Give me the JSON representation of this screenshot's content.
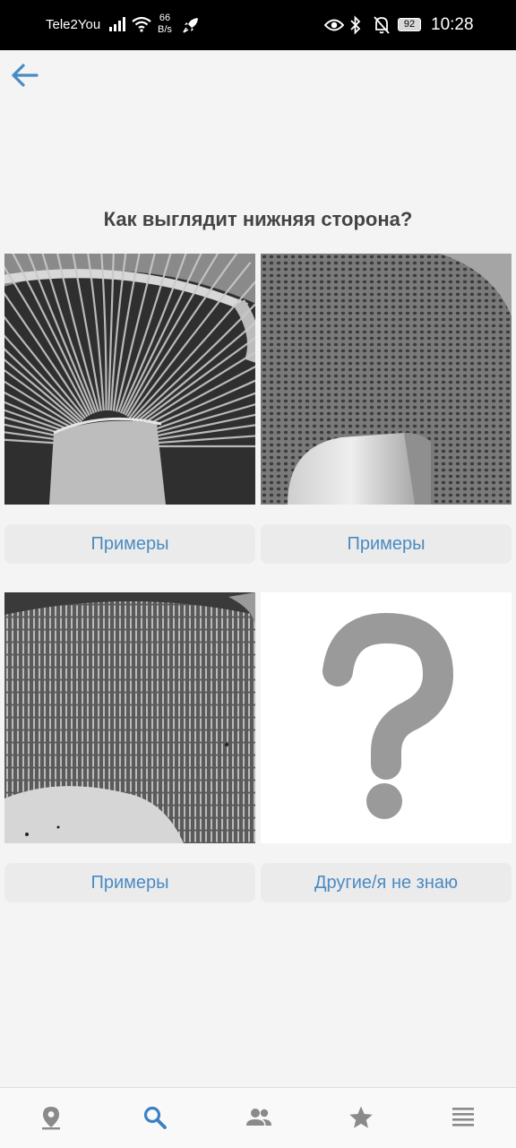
{
  "status_bar": {
    "carrier": "Tele2You",
    "speed_value": "66",
    "speed_unit": "B/s",
    "battery": "92",
    "time": "10:28"
  },
  "question": "Как выглядит нижняя сторона?",
  "options": [
    {
      "image": "gills-underside-photo",
      "button": "Примеры"
    },
    {
      "image": "pores-underside-photo",
      "button": "Примеры"
    },
    {
      "image": "teeth-underside-photo",
      "button": "Примеры"
    },
    {
      "image": "question-mark-icon",
      "button": "Другие/я не знаю"
    }
  ],
  "bottom_nav": [
    {
      "icon": "map-pin-icon",
      "active": false
    },
    {
      "icon": "search-icon",
      "active": true
    },
    {
      "icon": "people-icon",
      "active": false
    },
    {
      "icon": "star-icon",
      "active": false
    },
    {
      "icon": "menu-icon",
      "active": false
    }
  ],
  "colors": {
    "accent": "#4a8bc2",
    "active_nav": "#3b82c4",
    "inactive_nav": "#8a8a8a",
    "title": "#444444",
    "background": "#f4f4f4",
    "button_bg": "#ebebeb"
  }
}
